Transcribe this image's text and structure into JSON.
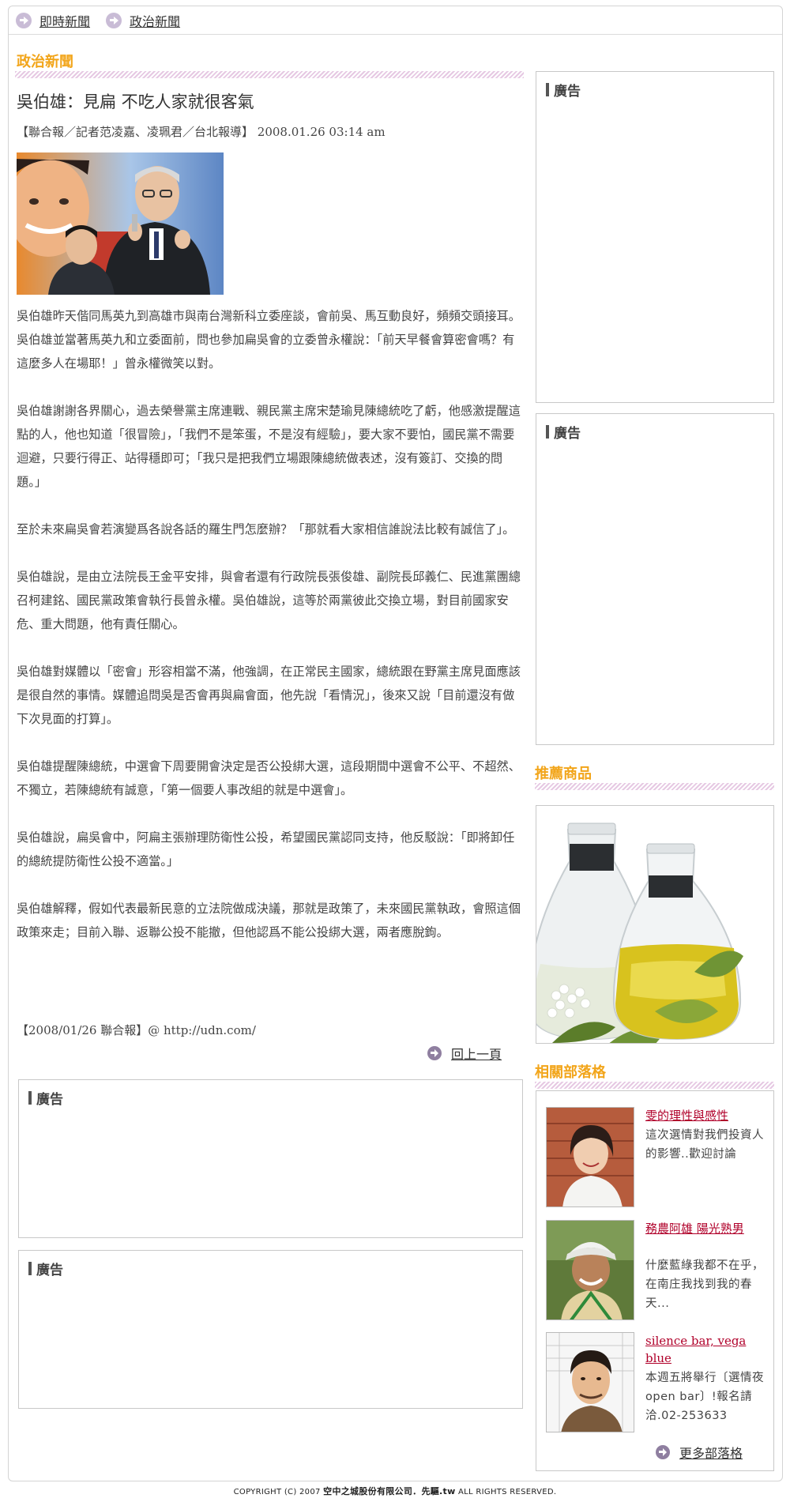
{
  "nav": {
    "items": [
      {
        "label": "即時新聞"
      },
      {
        "label": "政治新聞"
      }
    ]
  },
  "section": {
    "title": "政治新聞"
  },
  "article": {
    "headline": "吳伯雄：見扁 不吃人家就很客氣",
    "byline": "【聯合報／記者范凌嘉、凌珮君／台北報導】 2008.01.26 03:14 am",
    "paragraphs": [
      "吳伯雄昨天偕同馬英九到高雄市與南台灣新科立委座談，會前吳、馬互動良好，頻頻交頭接耳。吳伯雄並當著馬英九和立委面前，問也參加扁吳會的立委曾永權說：「前天早餐會算密會嗎？有這麼多人在場耶！」曾永權微笑以對。",
      "吳伯雄謝謝各界關心，過去榮譽黨主席連戰、親民黨主席宋楚瑜見陳總統吃了虧，他感激提醒這點的人，他也知道「很冒險」，「我們不是笨蛋，不是沒有經驗」，要大家不要怕，國民黨不需要迴避，只要行得正、站得穩即可；「我只是把我們立場跟陳總統做表述，沒有簽訂、交換的問題。」",
      "至於未來扁吳會若演變爲各說各話的羅生門怎麼辦？「那就看大家相信誰說法比較有誠信了」。",
      "吳伯雄說，是由立法院長王金平安排，與會者還有行政院長張俊雄、副院長邱義仁、民進黨團總召柯建銘、國民黨政策會執行長曾永權。吳伯雄說，這等於兩黨彼此交換立場，對目前國家安危、重大問題，他有責任關心。",
      "吳伯雄對媒體以「密會」形容相當不滿，他強調，在正常民主國家，總統跟在野黨主席見面應該是很自然的事情。媒體追問吳是否會再與扁會面，他先說「看情況」，後來又說「目前還沒有做下次見面的打算」。",
      "吳伯雄提醒陳總統，中選會下周要開會決定是否公投綁大選，這段期間中選會不公平、不超然、不獨立，若陳總統有誠意，「第一個要人事改組的就是中選會」。",
      "吳伯雄說，扁吳會中，阿扁主張辦理防衛性公投，希望國民黨認同支持，他反駁說：「即將卸任的總統提防衛性公投不適當。」",
      "吳伯雄解釋，假如代表最新民意的立法院做成決議，那就是政策了，未來國民黨執政，會照這個政策來走；目前入聯、返聯公投不能撤，但他認爲不能公投綁大選，兩者應脫鉤。"
    ],
    "source": "【2008/01/26 聯合報】@ http://udn.com/",
    "back_label": "回上一頁"
  },
  "ads": {
    "label": "廣告"
  },
  "product": {
    "title": "推薦商品"
  },
  "blogs": {
    "title": "相關部落格",
    "items": [
      {
        "title": "雯的理性與感性",
        "desc": "這次選情對我們投資人的影響..歡迎討論"
      },
      {
        "title": "務農阿雄 陽光熟男",
        "desc": "什麼藍綠我都不在乎，在南庄我找到我的春天..."
      },
      {
        "title": "silence bar, vega blue",
        "desc": "本週五將舉行〔選情夜open bar〕!報名請洽.02-253633"
      }
    ],
    "more_label": "更多部落格"
  },
  "footer": {
    "prefix": "COPYRIGHT (C) 2007",
    "brand": "空中之城股份有限公司．先驅.tw",
    "suffix": "ALL RIGHTS RESERVED."
  },
  "colors": {
    "accent": "#f2a51a",
    "link_red": "#b0002a",
    "stripe": "#e6c9e3"
  }
}
